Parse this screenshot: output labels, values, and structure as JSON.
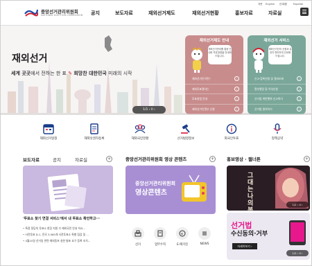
{
  "header": {
    "brand_name": "중앙선거관리위원회",
    "brand_sub": "NATIONAL ELECTION COMMISSION",
    "util_links": [
      "국문",
      "English",
      "日本語",
      "Español"
    ],
    "nav": [
      "공지",
      "보도자료",
      "재외선거제도",
      "재외선거현황",
      "홍보자료",
      "자료실"
    ]
  },
  "hero": {
    "title": "재외선거",
    "sub_prefix": "세계 곳곳",
    "sub_mid1": "에서 전하는 한 표",
    "sub_bold": "희망찬 대한민국",
    "sub_suffix": " 미래의 시작",
    "slider": "1/1 ‹ II ›"
  },
  "panels": [
    {
      "title": "재외선거제도 안내",
      "bubble": "재외선거관리를 통한 안내와 투표방법을 안내해 드립니다.",
      "items": [
        "재외선거인이란?",
        "재외투표절차는",
        "투표방법 안내",
        "재외선거인명부 신청"
      ]
    },
    {
      "title": "재외선거 서비스",
      "bubble": "재외선거인의 신청과 유권자 편리하게 안내해 드립니다.",
      "items": [
        "신고·등록신청 및 결과조회",
        "명부열람 및 이의신청",
        "선거법 위반행위 신고하기",
        "선거법 질의하기"
      ]
    }
  ],
  "quick": [
    "재외선거일정",
    "재외유권자등록",
    "재외국민현황",
    "선거법령정보",
    "외국인투표",
    "정책공약"
  ],
  "news": {
    "tabs": [
      "보도자료",
      "공지",
      "자료실"
    ],
    "headline": "'투표소 찾기 연결 서비스'에서 내 투표소 확인하고···",
    "bullets": [
      "특정 정당의 투표소 현장 지원 가 재외국민 안내 하시...",
      "사전투표 D-1, 전국 3,565개 사전투표소 특별 점검 및 ...",
      "4월10일 선거일 관련 재외동포 실천 발표 요구 등록 조치..."
    ]
  },
  "video": {
    "title": "중앙선거관리위원회 영상 콘텐츠",
    "banner_line1": "중앙선거관리위원회",
    "banner_line2": "영상콘텐츠",
    "icons": [
      "선거",
      "업무수칙",
      "E-매거진",
      "NEWS"
    ]
  },
  "promo": {
    "title": "홍보영상 · 웹너튼",
    "poster_text": "그대는 나의 봄",
    "big1": "선거법",
    "big2": "수신동의·거부",
    "button": "자세히보기 ›",
    "pager1": "1/2 ‹ II ›",
    "pager2": "1/2 ‹ II ›"
  }
}
